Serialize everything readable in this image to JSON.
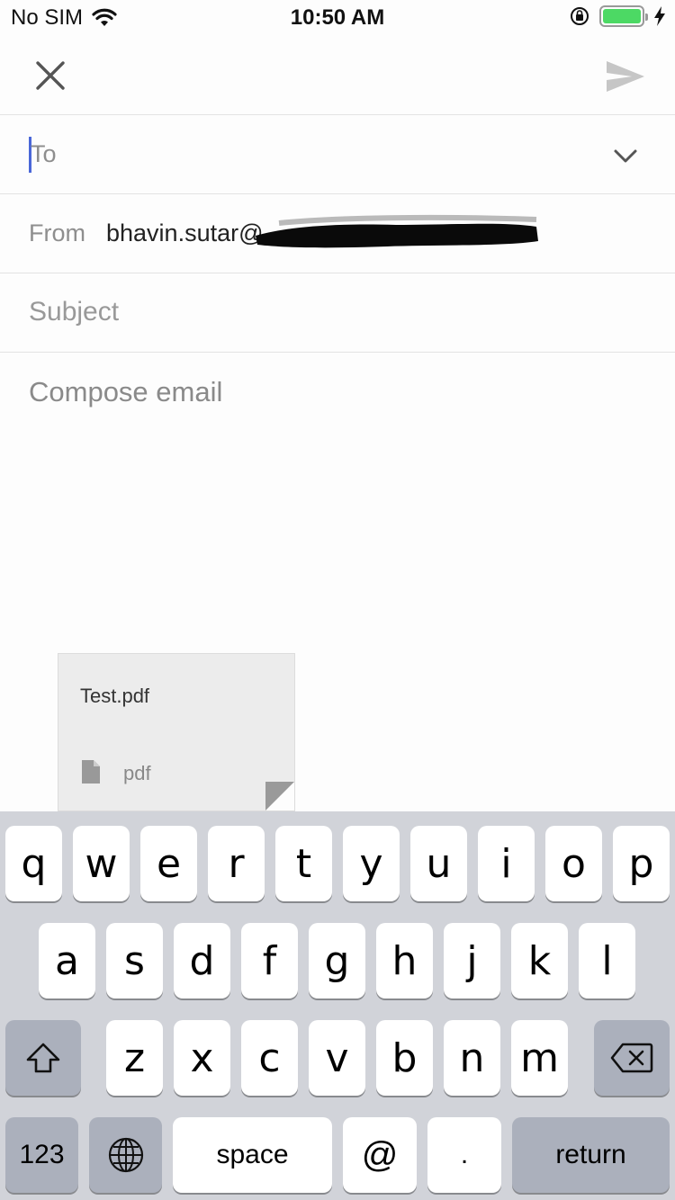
{
  "status_bar": {
    "carrier": "No SIM",
    "time": "10:50 AM",
    "icons": [
      "wifi-icon",
      "orientation-lock-icon",
      "battery-icon",
      "charging-icon"
    ],
    "battery_color": "#4cd964"
  },
  "toolbar": {
    "close_icon": "close-icon",
    "send_icon": "send-icon"
  },
  "compose": {
    "to_label": "To",
    "from_label": "From",
    "from_value": "bhavin.sutar@",
    "subject_placeholder": "Subject",
    "body_placeholder": "Compose email"
  },
  "attachment": {
    "file_name": "Test.pdf",
    "file_type": "pdf"
  },
  "keyboard": {
    "row1": [
      "q",
      "w",
      "e",
      "r",
      "t",
      "y",
      "u",
      "i",
      "o",
      "p"
    ],
    "row2": [
      "a",
      "s",
      "d",
      "f",
      "g",
      "h",
      "j",
      "k",
      "l"
    ],
    "row3": [
      "z",
      "x",
      "c",
      "v",
      "b",
      "n",
      "m"
    ],
    "numbers_label": "123",
    "space_label": "space",
    "at_label": "@",
    "period_label": ".",
    "return_label": "return"
  },
  "colors": {
    "caret": "#4a67d8",
    "keyboard_bg": "#d1d3d9",
    "function_key_bg": "#abb0bc"
  }
}
